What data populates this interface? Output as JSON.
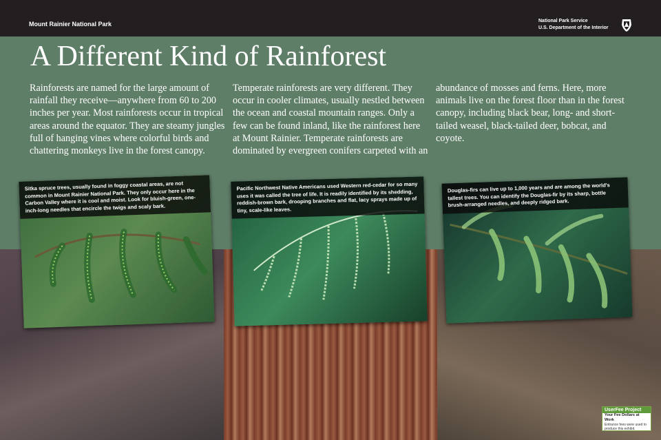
{
  "header": {
    "park_name": "Mount Rainier National Park",
    "agency_line1": "National Park Service",
    "agency_line2": "U.S. Department of the Interior",
    "logo_icon": "nps-arrowhead-icon"
  },
  "title": "A Different Kind of Rainforest",
  "columns": [
    "Rainforests are named for the large amount of rainfall they receive—anywhere from 60 to 200 inches per year. Most rainforests occur in tropical areas around the equator. They are steamy jungles full of hanging vines where colorful birds and chattering monkeys live in the forest canopy.",
    "Temperate rainforests are very different. They occur in cooler climates, usually nestled between the ocean and coastal mountain ranges. Only a few can be found inland, like the rainforest here at Mount Rainier. Temperate rainforests are dominated by evergreen conifers carpeted with an",
    "abundance of mosses and ferns. Here, more animals live on the forest floor than in the forest canopy, including black bear, long- and short-tailed weasel, black-tailed deer, bobcat, and coyote."
  ],
  "photos": [
    {
      "caption": "Sitka spruce trees, usually found in foggy coastal areas, are not common in Mount Rainier National Park. They only occur here in the Carbon Valley where it is cool and moist. Look for bluish-green, one-inch-long needles that encircle the twigs and scaly bark."
    },
    {
      "caption": "Pacific Northwest Native Americans used Western red-cedar for so many uses it was called the tree of life. It is readily identified by its shedding, reddish-brown bark, drooping branches and flat, lacy sprays made up of tiny, scale-like leaves."
    },
    {
      "caption": "Douglas-firs can live up to 1,000 years and are among the world's tallest trees. You can identify the Douglas-fir by its sharp, bottle brush-arranged needles, and deeply ridged bark."
    }
  ],
  "badge": {
    "brand_a": "UserFee",
    "brand_b": " Project",
    "subtitle": "Your Fee Dollars at Work",
    "body": "Entrance fees were used to produce this exhibit."
  },
  "colors": {
    "panel_green": "#5f7e68",
    "header_black": "#231f20",
    "badge_green": "#5f9a3a"
  }
}
